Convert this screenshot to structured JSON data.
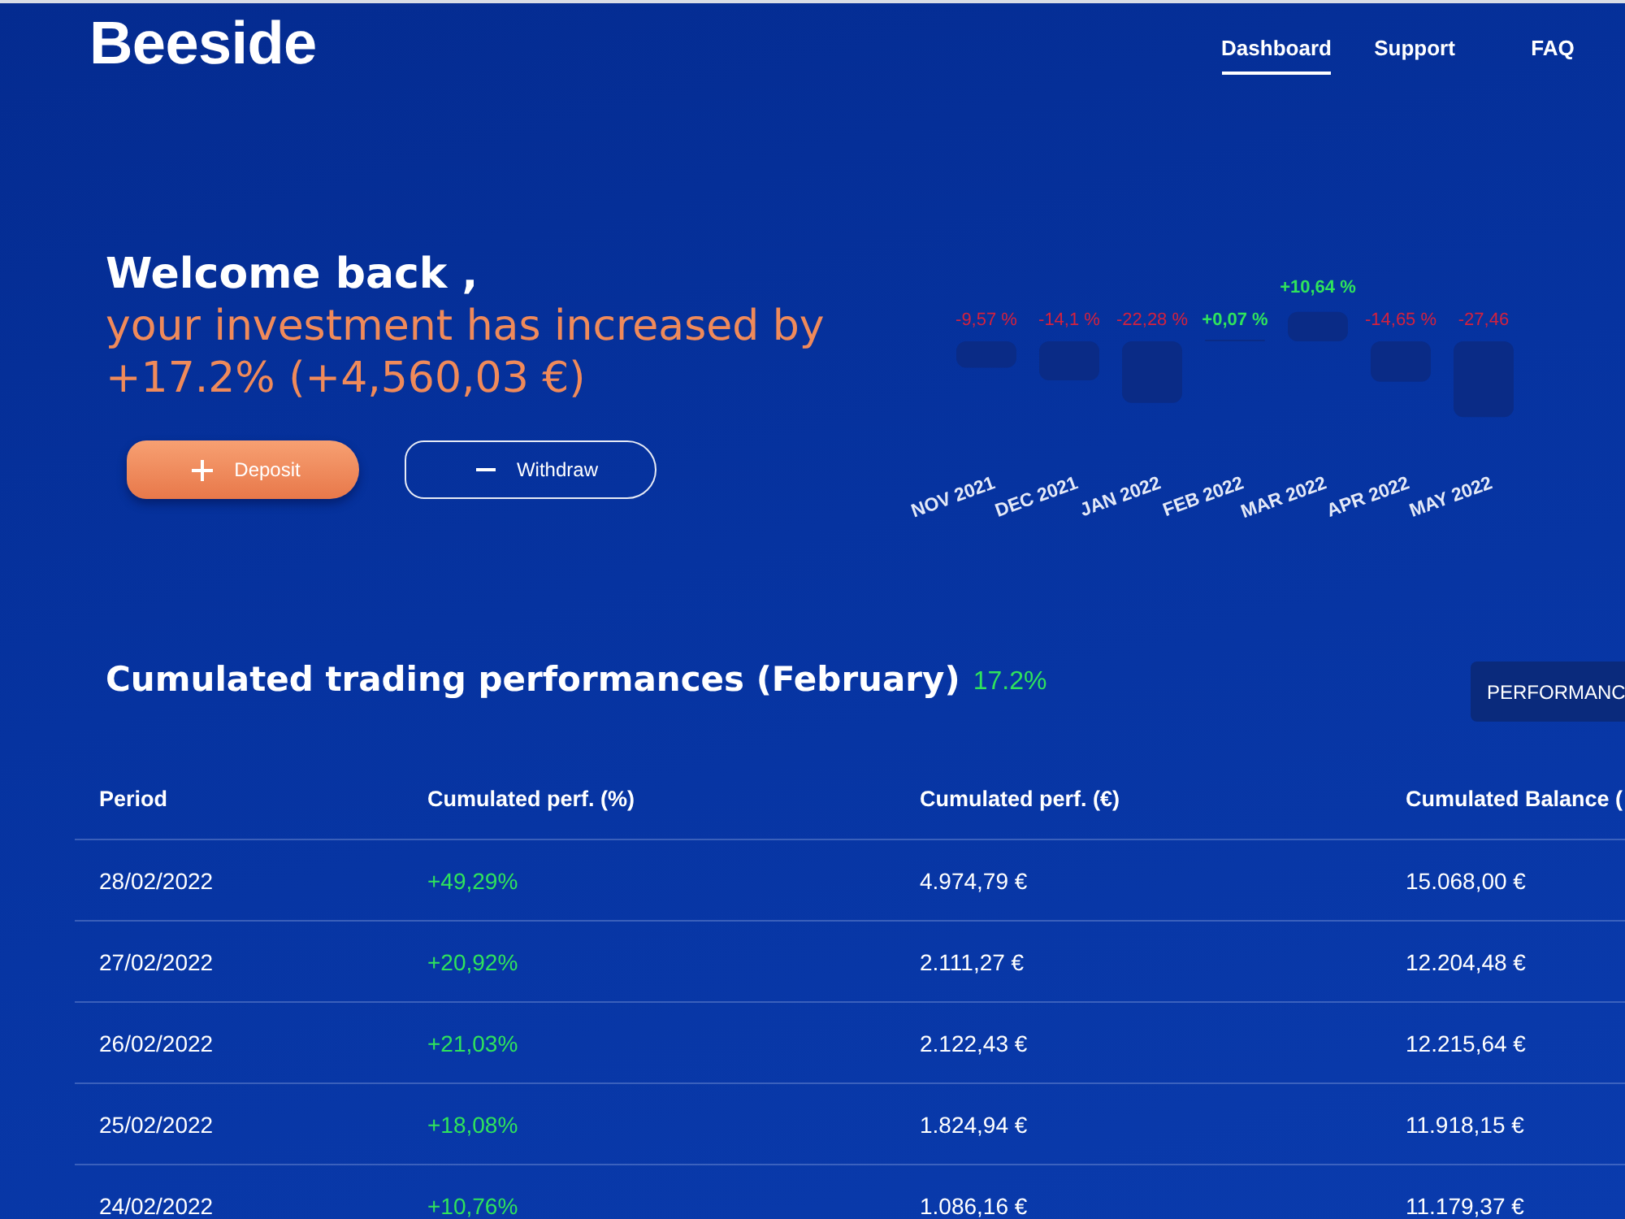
{
  "header": {
    "logo": "Beeside",
    "nav": [
      {
        "label": "Dashboard",
        "selected": true
      },
      {
        "label": "Support",
        "selected": false
      },
      {
        "label": "FAQ",
        "selected": false
      }
    ]
  },
  "hero": {
    "greeting": "Welcome back ,",
    "message": "your investment has increased by +17.2% (+4,560,03 €)",
    "buttons": [
      {
        "kind": "deposit",
        "label": "Deposit"
      },
      {
        "kind": "withdraw",
        "label": "Withdraw"
      }
    ]
  },
  "monthly_chart": {
    "chart_data": {
      "type": "bar",
      "categories": [
        "NOV 2021",
        "DEC 2021",
        "JAN 2022",
        "FEB 2022",
        "MAR 2022",
        "APR 2022",
        "MAY 2022"
      ],
      "values": [
        -9.57,
        -14.1,
        -22.28,
        0.07,
        10.64,
        -14.65,
        -27.46
      ],
      "color": "#0a2b86",
      "value_labels": [
        "-9,57 %",
        "-14,1 %",
        "-22,28 %",
        "+0,07 %",
        "+10,64 %",
        "-14,65 %",
        "-27,46"
      ]
    }
  },
  "performance": {
    "title": "Cumulated trading performances (February)",
    "total": "17.2%",
    "view_button": "PERFORMANC",
    "table": {
      "columns": [
        {
          "label": "Period",
          "kind": "text"
        },
        {
          "label": "Cumulated perf. (%)",
          "kind": "percent"
        },
        {
          "label": "Cumulated perf. (€)",
          "kind": "text"
        },
        {
          "label": "Cumulated Balance (",
          "kind": "text"
        }
      ],
      "rows": [
        [
          "28/02/2022",
          "+49,29%",
          "4.974,79 €",
          "15.068,00 €"
        ],
        [
          "27/02/2022",
          "+20,92%",
          "2.111,27 €",
          "12.204,48 €"
        ],
        [
          "26/02/2022",
          "+21,03%",
          "2.122,43 €",
          "12.215,64 €"
        ],
        [
          "25/02/2022",
          "+18,08%",
          "1.824,94 €",
          "11.918,15 €"
        ],
        [
          "24/02/2022",
          "+10,76%",
          "1.086,16 €",
          "11.179,37 €"
        ]
      ]
    }
  }
}
